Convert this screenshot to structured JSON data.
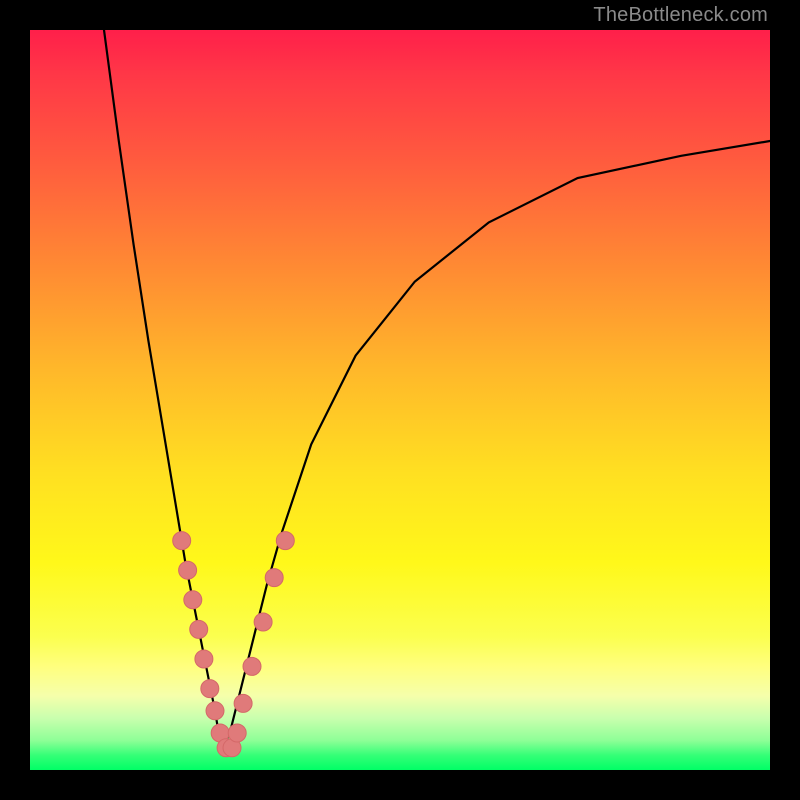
{
  "watermark": "TheBottleneck.com",
  "colors": {
    "frame": "#000000",
    "curve": "#000000",
    "marker_fill": "#e07a7a",
    "marker_stroke": "#d46868"
  },
  "chart_data": {
    "type": "line",
    "title": "",
    "xlabel": "",
    "ylabel": "",
    "xlim": [
      0,
      100
    ],
    "ylim": [
      0,
      100
    ],
    "grid": false,
    "legend": false,
    "series": [
      {
        "name": "left_branch",
        "x": [
          10,
          12,
          14,
          16,
          18,
          20,
          21,
          22,
          23,
          24,
          25,
          25.5,
          26
        ],
        "y": [
          100,
          85,
          71,
          58,
          46,
          34,
          28,
          23,
          18,
          13,
          8,
          5,
          3
        ]
      },
      {
        "name": "right_branch",
        "x": [
          26,
          27,
          28,
          30,
          32,
          34,
          38,
          44,
          52,
          62,
          74,
          88,
          100
        ],
        "y": [
          3,
          5,
          9,
          17,
          25,
          32,
          44,
          56,
          66,
          74,
          80,
          83,
          85
        ]
      }
    ],
    "markers": [
      {
        "x": 20.5,
        "y": 31
      },
      {
        "x": 21.3,
        "y": 27
      },
      {
        "x": 22.0,
        "y": 23
      },
      {
        "x": 22.8,
        "y": 19
      },
      {
        "x": 23.5,
        "y": 15
      },
      {
        "x": 24.3,
        "y": 11
      },
      {
        "x": 25.0,
        "y": 8
      },
      {
        "x": 25.7,
        "y": 5
      },
      {
        "x": 26.5,
        "y": 3
      },
      {
        "x": 27.3,
        "y": 3
      },
      {
        "x": 28.0,
        "y": 5
      },
      {
        "x": 28.8,
        "y": 9
      },
      {
        "x": 30.0,
        "y": 14
      },
      {
        "x": 31.5,
        "y": 20
      },
      {
        "x": 33.0,
        "y": 26
      },
      {
        "x": 34.5,
        "y": 31
      }
    ]
  }
}
